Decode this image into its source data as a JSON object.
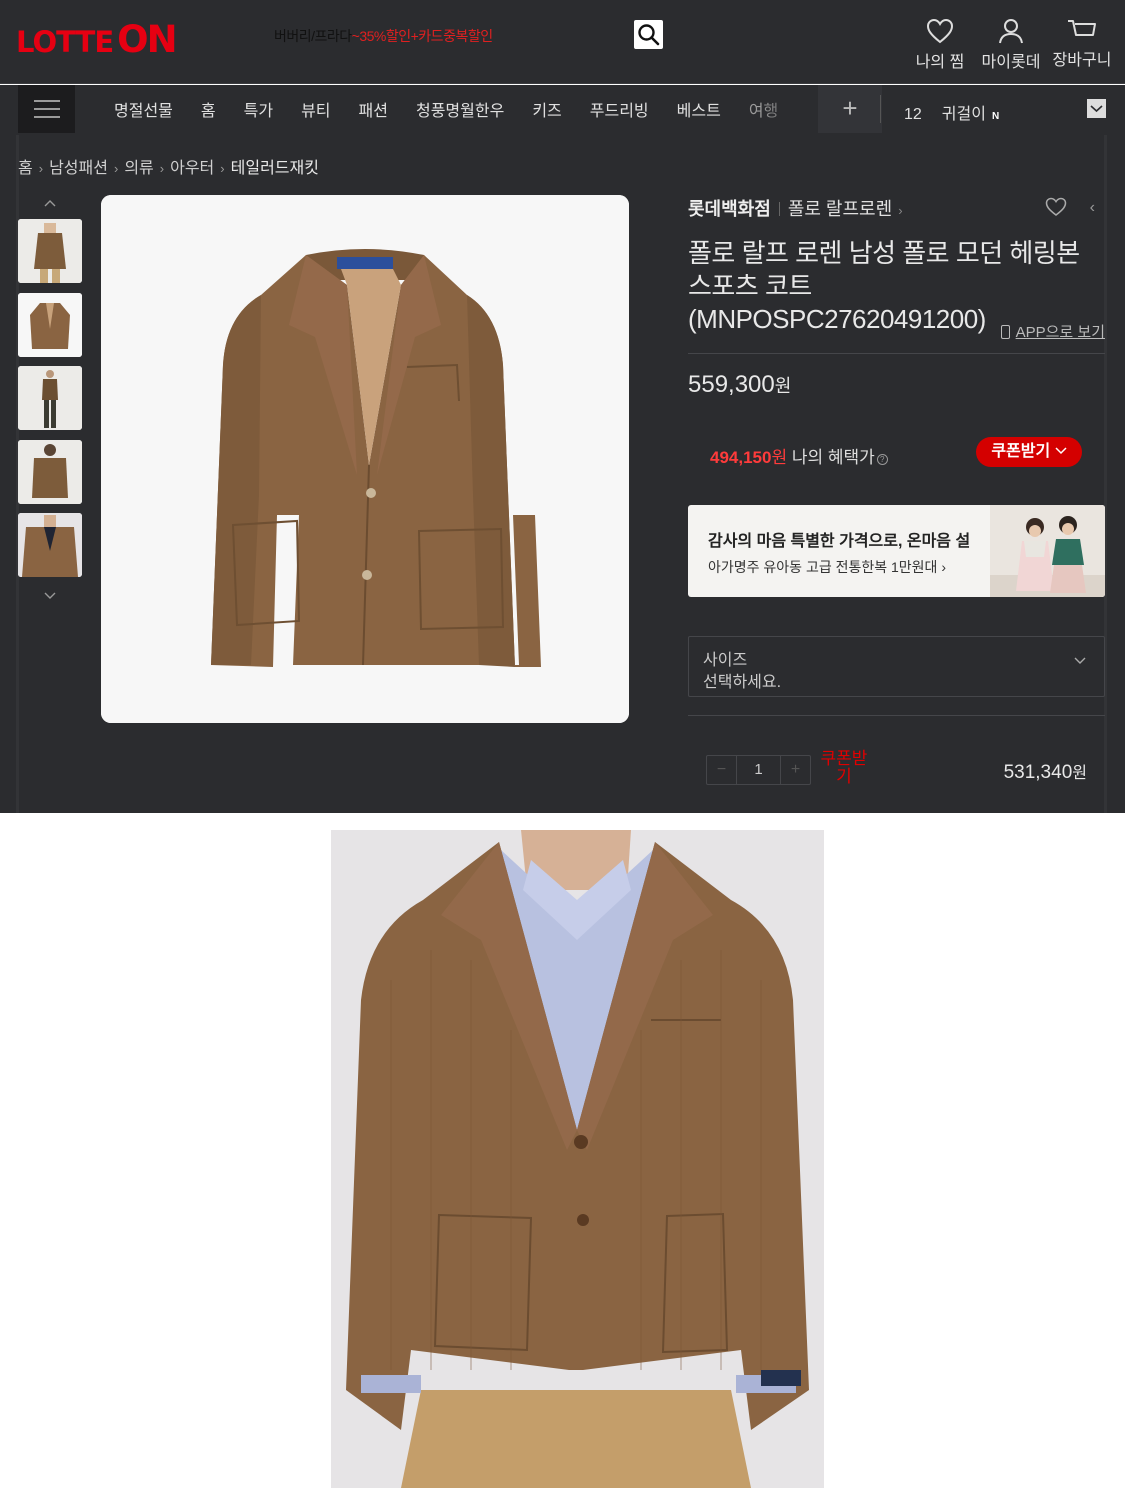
{
  "header": {
    "logo_text_a": "LOTTE",
    "logo_text_b": "ON",
    "search_text": "버버리/프라다",
    "search_promo": "~35%할인+카드중복할인",
    "wish_label": "나의 찜",
    "my_label": "마이롯데",
    "cart_label": "장바구니"
  },
  "nav": {
    "items": [
      "명절선물",
      "홈",
      "특가",
      "뷰티",
      "패션",
      "청풍명월한우",
      "키즈",
      "푸드리빙",
      "베스트",
      "여행"
    ],
    "rank_num": "12",
    "rank_keyword": "귀걸이",
    "rank_badge": "N"
  },
  "breadcrumb": [
    "홈",
    "남성패션",
    "의류",
    "아우터",
    "테일러드재킷"
  ],
  "product": {
    "store": "롯데백화점",
    "brand": "폴로 랄프로렌",
    "name": "폴로 랄프 로렌 남성 폴로 모던 헤링본 스포츠 코트(MNPOSPC27620491200)",
    "app_link": "APP으로 보기",
    "price": "559,300",
    "currency": "원",
    "benefit_price": "494,150",
    "benefit_label": "나의 혜택가",
    "coupon_button": "쿠폰받기",
    "banner_title": "감사의 마음 특별한 가격으로, 온마음 설",
    "banner_sub": "아가명주 유아동 고급 전통한복 1만원대",
    "size_label": "사이즈",
    "size_placeholder": "선택하세요.",
    "quantity": "1",
    "qty_coupon": "쿠폰받기",
    "total_price": "531,340"
  },
  "colors": {
    "brand_red": "#e60012",
    "bg_dark": "#2b2c2f",
    "jacket_brown": "#8a6442",
    "coupon_red": "#d40000"
  }
}
